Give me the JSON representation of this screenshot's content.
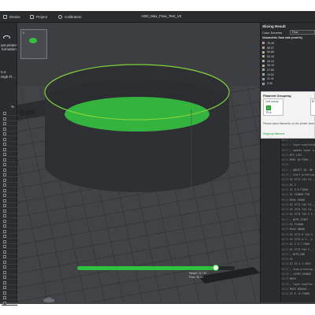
{
  "window": {
    "title": "H2D_Max_Flow_Test_V2"
  },
  "topbar": {
    "items": [
      {
        "label": "Device",
        "icon": "monitor-icon"
      },
      {
        "label": "Project",
        "icon": "folder-icon"
      },
      {
        "label": "Calibration",
        "icon": "calibration-icon"
      }
    ]
  },
  "left_panel": {
    "printer_text_1": "ant printer",
    "printer_text_2": "formation",
    "nozzle_value": "0.4",
    "nozzle_flow": "High Fl...",
    "percent": "%"
  },
  "thumbnail": {
    "index": "1"
  },
  "slicing": {
    "title": "Slicing Result",
    "color_scheme_label": "Color Scheme",
    "color_scheme_value": "Flow",
    "legend_title": "Volumetric flow rate (mm³/s)",
    "legend": [
      {
        "value": "76.28",
        "color": "#ff3b1f"
      },
      {
        "value": "68.57",
        "color": "#ff7a1a"
      },
      {
        "value": "60.86",
        "color": "#ffb21a"
      },
      {
        "value": "53.15",
        "color": "#f3e31d"
      },
      {
        "value": "45.44",
        "color": "#c5e61f"
      },
      {
        "value": "35.76",
        "color": "#7ede2b"
      },
      {
        "value": "27.65",
        "color": "#35c64a"
      },
      {
        "value": "19.02",
        "color": "#1aa6a8"
      },
      {
        "value": "11.41",
        "color": "#1e6fd1"
      },
      {
        "value": "3.30",
        "color": "#2d3bd4"
      }
    ]
  },
  "grouping": {
    "title": "Filament Grouping",
    "left_nozzle": "Left nozzle",
    "right_nozzle": "Ri",
    "filament_label": "PLA",
    "hint": "Please place filaments on the printer base",
    "regroup": "Regroup filament"
  },
  "layer_info": {
    "line1": "Height: 117.87",
    "line2": "Flow: 18.61"
  },
  "gcode": [
    {
      "num": "16111",
      "text": "; ..."
    },
    {
      "num": "16112",
      "text": "; layer num/total..."
    },
    {
      "num": "16113",
      "text": "; update layer p..."
    },
    {
      "num": "16114",
      "text": "M73 L391"
    },
    {
      "num": "16115",
      "text": "M991 S0 P390 ;"
    },
    {
      "num": "16116",
      "text": ""
    },
    {
      "num": "16117",
      "text": "; OBJECT_ID: 88"
    },
    {
      "num": "16118",
      "text": "; start printing..."
    },
    {
      "num": "16119",
      "text": "G1 X773 Y44 F4..."
    },
    {
      "num": "16120",
      "text": "G1 Z"
    },
    {
      "num": "16121",
      "text": "G1 E.8 F1800"
    },
    {
      "num": "16122",
      "text": "G1 F28800 F90"
    },
    {
      "num": "16123",
      "text": "M204 S5000"
    },
    {
      "num": "16124",
      "text": "G1 X773 Y42 F4..."
    },
    {
      "num": "16125",
      "text": "G1 X774 Y44 Y4..."
    },
    {
      "num": "16126",
      "text": "G1 X775 Y43.9 F..."
    },
    {
      "num": "16127",
      "text": "; WIPE_START"
    },
    {
      "num": "16128",
      "text": "G1 F24000"
    },
    {
      "num": "16129",
      "text": "M204 S8000"
    },
    {
      "num": "16130",
      "text": "G1 X773.8 Y44.9"
    },
    {
      "num": "16131",
      "text": "G1 X773.4 Y...2"
    },
    {
      "num": "16132",
      "text": "G1 Z 5-7.F800"
    },
    {
      "num": "16133",
      "text": "G1 X775 Y44 F..."
    },
    {
      "num": "16134",
      "text": "; WIPE_END"
    },
    {
      "num": "16135",
      "text": "G1"
    },
    {
      "num": "16136",
      "text": "G1 E3.4.Y.2057"
    },
    {
      "num": "16137",
      "text": "; stop printing ..."
    },
    {
      "num": "16138",
      "text": "; LAYER_CHANGE"
    },
    {
      "num": "16139",
      "text": "M625"
    },
    {
      "num": "16140",
      "text": "; layer num/tot..."
    },
    {
      "num": "16141",
      "text": "M624 AQAAAA..."
    },
    {
      "num": "16142",
      "text": "G1 E-.8 F1800"
    }
  ],
  "progress": {
    "fraction": 0.88
  },
  "colors": {
    "accent": "#2ec23f",
    "background": "#3d3e42",
    "panel": "#2b2c2f"
  }
}
